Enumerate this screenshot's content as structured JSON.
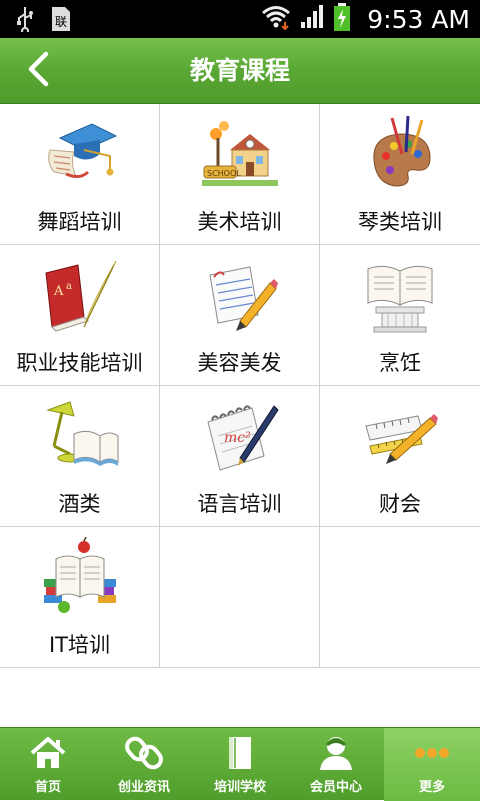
{
  "status_bar": {
    "time": "9:53 AM"
  },
  "header": {
    "title": "教育课程"
  },
  "courses": [
    {
      "label": "舞蹈培训",
      "icon": "graduation-cap-icon"
    },
    {
      "label": "美术培训",
      "icon": "school-house-icon"
    },
    {
      "label": "琴类培训",
      "icon": "paint-palette-icon"
    },
    {
      "label": "职业技能培训",
      "icon": "book-feather-icon"
    },
    {
      "label": "美容美发",
      "icon": "notepad-pencil-icon"
    },
    {
      "label": "烹饪",
      "icon": "open-book-column-icon"
    },
    {
      "label": "酒类",
      "icon": "desk-lamp-book-icon"
    },
    {
      "label": "语言培训",
      "icon": "spiral-notebook-pen-icon"
    },
    {
      "label": "财会",
      "icon": "ruler-pencil-icon"
    },
    {
      "label": "IT培训",
      "icon": "books-apple-icon"
    }
  ],
  "tabs": [
    {
      "label": "首页",
      "icon": "home-icon"
    },
    {
      "label": "创业资讯",
      "icon": "link-icon"
    },
    {
      "label": "培训学校",
      "icon": "book-icon"
    },
    {
      "label": "会员中心",
      "icon": "user-icon"
    },
    {
      "label": "更多",
      "icon": "more-dots-icon",
      "active": true
    }
  ],
  "colors": {
    "header_green": "#5aa834",
    "tab_green": "#4f9d2b",
    "active_tab": "#7dc554"
  }
}
